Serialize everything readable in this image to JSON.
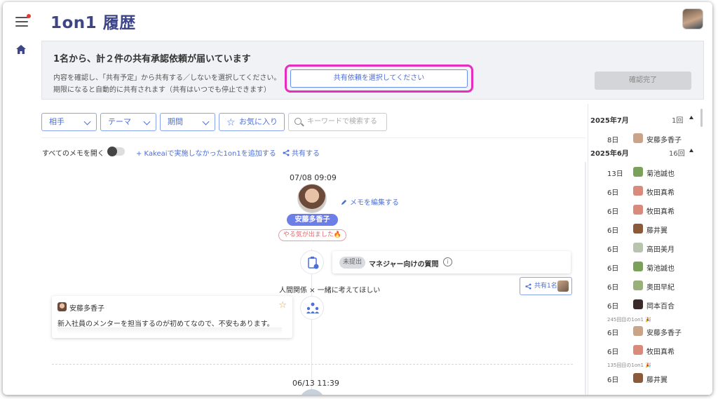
{
  "header": {
    "title": "1on1 履歴"
  },
  "banner": {
    "title": "1名から、計２件の共有承認依頼が届いています",
    "line1": "内容を確認し、「共有予定」から共有する／しないを選択してください。",
    "line2": "期限になると自動的に共有されます（共有はいつでも停止できます）",
    "select_label": "共有依頼を選択してください",
    "confirm_label": "確認完了"
  },
  "filters": {
    "partner": "相手",
    "theme": "テーマ",
    "period": "期間",
    "favorites": "お気に入り",
    "search_placeholder": "キーワードで検索する"
  },
  "toolbar": {
    "open_all": "すべてのメモを開く",
    "add_link": "+ Kakeaiで実施しなかった1on1を追加する",
    "share_link": "共有する"
  },
  "timeline": {
    "entry1": {
      "datetime": "07/08 09:09",
      "name": "安藤多香子",
      "mood": "やる気が出ました🔥",
      "edit_memo": "メモを編集する",
      "question_badge": "未提出",
      "question_text": "マネジャー向けの質問",
      "topic": "人間関係 × 一緒に考えてほしい",
      "shared_label": "共有1名",
      "memo": {
        "name": "安藤多香子",
        "text": "新入社員のメンターを担当するのが初めてなので、不安もあります。"
      }
    },
    "entry2": {
      "datetime": "06/13 11:39"
    }
  },
  "history": {
    "months": [
      {
        "label": "2025年7月",
        "count": "1回"
      },
      {
        "label": "2025年6月",
        "count": "16回"
      }
    ],
    "items": [
      {
        "day": "8日",
        "name": "安藤多香子",
        "color": "#c9a488"
      },
      {
        "day": "13日",
        "name": "菊池誠也",
        "color": "#7aa05a"
      },
      {
        "day": "6日",
        "name": "牧田真希",
        "color": "#d98a7a"
      },
      {
        "day": "6日",
        "name": "牧田真希",
        "color": "#d98a7a"
      },
      {
        "day": "6日",
        "name": "藤井翼",
        "color": "#8a5a3a"
      },
      {
        "day": "6日",
        "name": "高田美月",
        "color": "#b8c4b0"
      },
      {
        "day": "6日",
        "name": "菊池誠也",
        "color": "#7aa05a"
      },
      {
        "day": "6日",
        "name": "奥田早紀",
        "color": "#9ab07a"
      },
      {
        "day": "6日",
        "name": "岡本百合",
        "color": "#3a2a2a"
      },
      {
        "day": "6日",
        "name": "安藤多香子",
        "color": "#c9a488"
      },
      {
        "day": "6日",
        "name": "牧田真希",
        "color": "#d98a7a"
      },
      {
        "day": "6日",
        "name": "藤井翼",
        "color": "#8a5a3a"
      }
    ],
    "notes": [
      "245回目の1on1 🎉",
      "135回目の1on1 🎉"
    ]
  }
}
